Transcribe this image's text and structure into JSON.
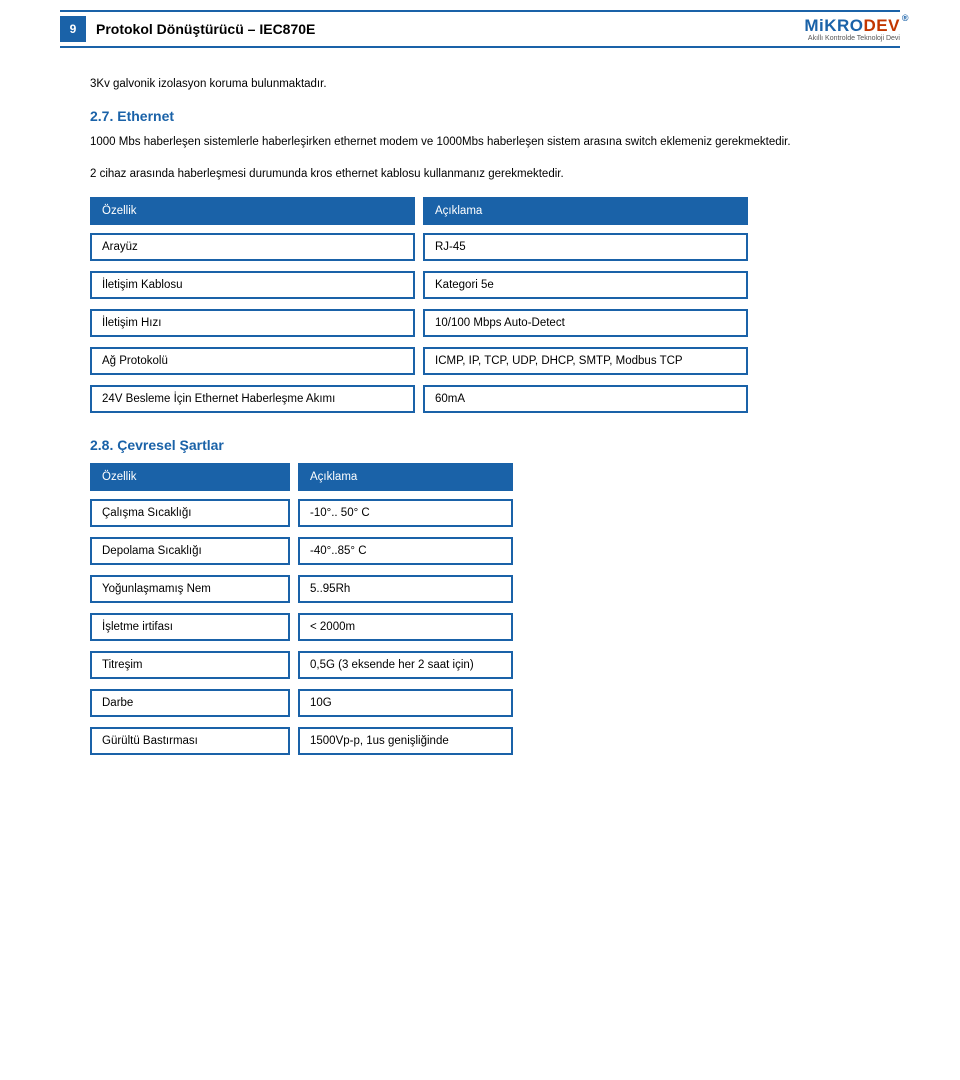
{
  "header": {
    "page_num": "9",
    "title": "Protokol Dönüştürücü – IEC870E",
    "logo_main_left": "MiKRO",
    "logo_main_right": "DEV",
    "logo_reg": "®",
    "logo_sub": "Akıllı Kontrolde Teknoloji Devi"
  },
  "intro_line": "3Kv galvonik izolasyon koruma bulunmaktadır.",
  "section27": {
    "num_title": "2.7. Ethernet",
    "p1": "1000 Mbs haberleşen sistemlerle haberleşirken ethernet modem ve 1000Mbs haberleşen sistem arasına switch eklemeniz gerekmektedir.",
    "p2": "2 cihaz arasında haberleşmesi durumunda kros ethernet kablosu kullanmanız gerekmektedir.",
    "th1": "Özellik",
    "th2": "Açıklama",
    "rows": [
      {
        "l": "Arayüz",
        "r": "RJ-45"
      },
      {
        "l": "İletişim Kablosu",
        "r": "Kategori 5e"
      },
      {
        "l": "İletişim Hızı",
        "r": "10/100 Mbps Auto-Detect"
      },
      {
        "l": "Ağ Protokolü",
        "r": "ICMP, IP, TCP, UDP, DHCP, SMTP, Modbus TCP"
      },
      {
        "l": "24V Besleme İçin Ethernet Haberleşme Akımı",
        "r": "60mA"
      }
    ]
  },
  "section28": {
    "num_title": "2.8. Çevresel Şartlar",
    "th1": "Özellik",
    "th2": "Açıklama",
    "rows": [
      {
        "l": "Çalışma Sıcaklığı",
        "r": "-10°.. 50° C"
      },
      {
        "l": "Depolama Sıcaklığı",
        "r": "-40°..85° C"
      },
      {
        "l": "Yoğunlaşmamış Nem",
        "r": "5..95Rh"
      },
      {
        "l": "İşletme irtifası",
        "r": "< 2000m"
      },
      {
        "l": "Titreşim",
        "r": "0,5G (3 eksende her 2 saat için)"
      },
      {
        "l": "Darbe",
        "r": "10G"
      },
      {
        "l": "Gürültü Bastırması",
        "r": "1500Vp-p, 1us genişliğinde"
      }
    ]
  }
}
